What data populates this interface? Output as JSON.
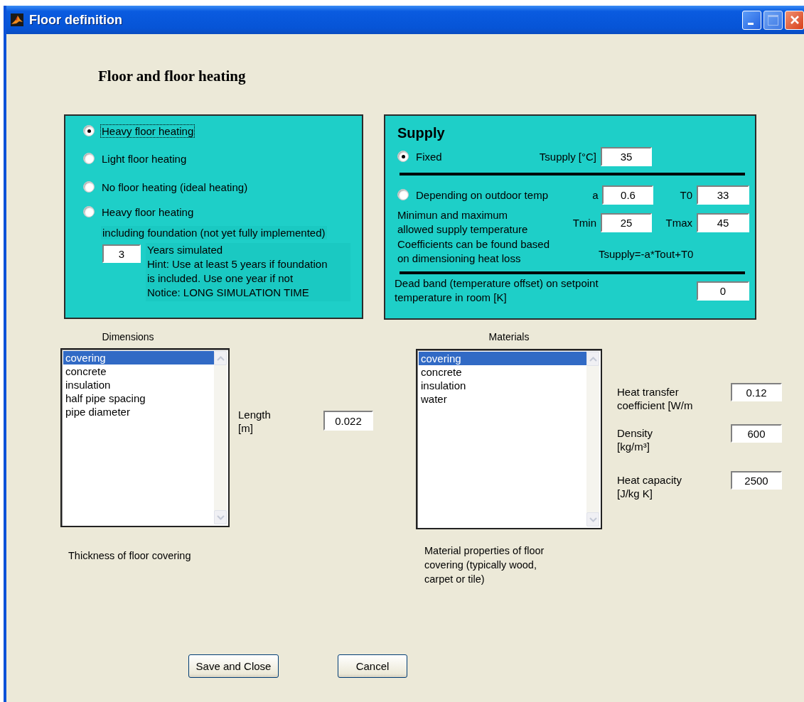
{
  "window": {
    "title": "Floor definition"
  },
  "heading": "Floor and floor heating",
  "floor_type": {
    "options": [
      {
        "label": "Heavy floor heating",
        "selected": true
      },
      {
        "label": "Light floor heating",
        "selected": false
      },
      {
        "label": "No floor heating (ideal heating)",
        "selected": false
      },
      {
        "label": "Heavy floor heating",
        "selected": false
      }
    ],
    "note": "including foundation (not yet fully implemented)",
    "years": {
      "value": "3",
      "text": "Years simulated\nHint: Use at least 5 years if foundation\nis included. Use one year if not\nNotice: LONG SIMULATION TIME"
    }
  },
  "supply": {
    "title": "Supply",
    "fixed": {
      "label": "Fixed",
      "selected": true,
      "field_label": "Tsupply [°C]",
      "value": "35"
    },
    "depending": {
      "label": "Depending on outdoor temp",
      "selected": false,
      "a_label": "a",
      "a_value": "0.6",
      "t0_label": "T0",
      "t0_value": "33"
    },
    "limits": {
      "text": "Minimun and maximum\nallowed supply temperature",
      "min_label": "Tmin",
      "min_value": "25",
      "max_label": "Tmax",
      "max_value": "45"
    },
    "coefficients": {
      "text": "Coefficients can be found based\non dimensioning heat loss",
      "formula": "Tsupply=-a*Tout+T0"
    },
    "dead_band": {
      "text": "Dead band (temperature offset) on setpoint\ntemperature in room [K]",
      "value": "0"
    }
  },
  "dimensions": {
    "label": "Dimensions",
    "items": [
      {
        "label": "covering",
        "selected": true
      },
      {
        "label": "concrete",
        "selected": false
      },
      {
        "label": "insulation",
        "selected": false
      },
      {
        "label": "half pipe spacing",
        "selected": false
      },
      {
        "label": "pipe diameter",
        "selected": false
      }
    ],
    "field_label": "Length\n[m]",
    "value": "0.022",
    "description": "Thickness of floor covering"
  },
  "materials": {
    "label": "Materials",
    "items": [
      {
        "label": "covering",
        "selected": true
      },
      {
        "label": "concrete",
        "selected": false
      },
      {
        "label": "insulation",
        "selected": false
      },
      {
        "label": "water",
        "selected": false
      }
    ],
    "properties": [
      {
        "label": "Heat transfer\ncoefficient [W/m",
        "value": "0.12"
      },
      {
        "label": "Density\n[kg/m³]",
        "value": "600"
      },
      {
        "label": "Heat capacity\n[J/kg K]",
        "value": "2500"
      }
    ],
    "description": "Material properties of floor\ncovering (typically wood,\ncarpet or tile)"
  },
  "buttons": [
    {
      "label": "Save and Close"
    },
    {
      "label": "Cancel"
    }
  ]
}
